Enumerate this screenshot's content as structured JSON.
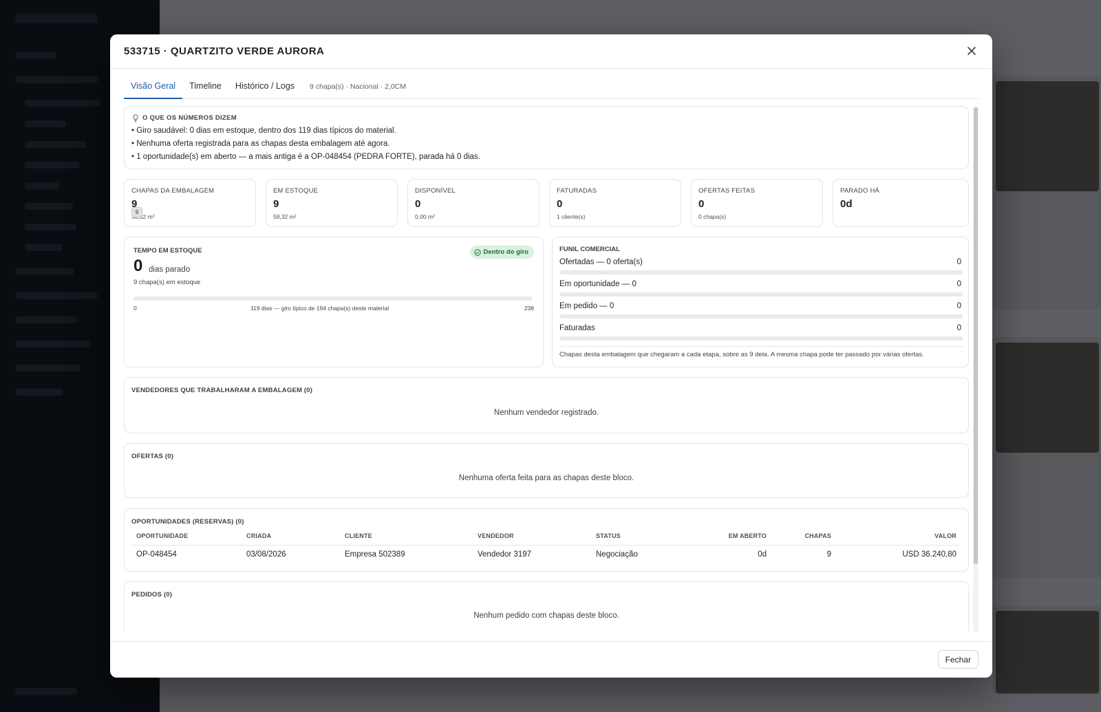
{
  "modal": {
    "title": "533715 · QUARTZITO VERDE AURORA",
    "close_icon": "close-icon",
    "footer_close_label": "Fechar"
  },
  "tabs": [
    {
      "label": "Visão Geral",
      "active": true
    },
    {
      "label": "Timeline",
      "active": false
    },
    {
      "label": "Histórico / Logs",
      "active": false
    }
  ],
  "tab_meta": "9 chapa(s) · Nacional · 2,0CM",
  "insights": {
    "icon": "lightbulb-icon",
    "title": "O QUE OS NÚMEROS DIZEM",
    "lines": [
      "• Giro saudável: 0 dias em estoque, dentro dos 119 dias típicos do material.",
      "• Nenhuma oferta registrada para as chapas desta embalagem até agora.",
      "• 1 oportunidade(s) em aberto — a mais antiga é a OP-048454 (PEDRA FORTE), parada há 0 dias."
    ]
  },
  "stats": [
    {
      "label": "CHAPAS DA EMBALAGEM",
      "value": "9",
      "sub": "58,32 m²",
      "tooltip": "9"
    },
    {
      "label": "EM ESTOQUE",
      "value": "9",
      "sub": "58,32 m²"
    },
    {
      "label": "DISPONÍVEL",
      "value": "0",
      "sub": "0,00 m²"
    },
    {
      "label": "FATURADAS",
      "value": "0",
      "sub": "1 cliente(s)"
    },
    {
      "label": "OFERTAS FEITAS",
      "value": "0",
      "sub": "0 chapa(s)"
    },
    {
      "label": "PARADO HÁ",
      "value": "0d",
      "sub": ""
    }
  ],
  "tempo": {
    "title": "TEMPO EM ESTOQUE",
    "badge": "Dentro do giro",
    "badge_icon": "check-circle-icon",
    "days": "0",
    "unit": "dias parado",
    "sub": "9 chapa(s) em estoque",
    "axis_min": "0",
    "axis_mid": "119 dias — giro típico de 194 chapa(s) deste material",
    "axis_max": "238",
    "progress_fraction": 0
  },
  "funil": {
    "title": "FUNIL COMERCIAL",
    "rows": [
      {
        "label": "Ofertadas — 0 oferta(s)",
        "count": "0",
        "fraction": 0
      },
      {
        "label": "Em oportunidade — 0",
        "count": "0",
        "fraction": 0
      },
      {
        "label": "Em pedido — 0",
        "count": "0",
        "fraction": 0
      },
      {
        "label": "Faturadas",
        "count": "0",
        "fraction": 0
      }
    ],
    "note": "Chapas desta embalagem que chegaram a cada etapa, sobre as 9 dela. A mesma chapa pode ter passado por várias ofertas."
  },
  "vendedores": {
    "title": "VENDEDORES QUE TRABALHARAM A EMBALAGEM  (0)",
    "empty": "Nenhum vendedor registrado."
  },
  "ofertas": {
    "title": "OFERTAS  (0)",
    "empty": "Nenhuma oferta feita para as chapas deste bloco."
  },
  "oportunidades": {
    "title": "OPORTUNIDADES (RESERVAS)  (0)",
    "columns": [
      "OPORTUNIDADE",
      "CRIADA",
      "CLIENTE",
      "VENDEDOR",
      "STATUS",
      "EM ABERTO",
      "CHAPAS",
      "VALOR"
    ],
    "rows": [
      [
        "OP-048454",
        "03/08/2026",
        "Empresa 502389",
        "Vendedor 3197",
        "Negociação",
        "0d",
        "9",
        "USD 36.240,80"
      ]
    ]
  },
  "pedidos": {
    "title": "PEDIDOS  (0)",
    "empty": "Nenhum pedido com chapas deste bloco."
  }
}
